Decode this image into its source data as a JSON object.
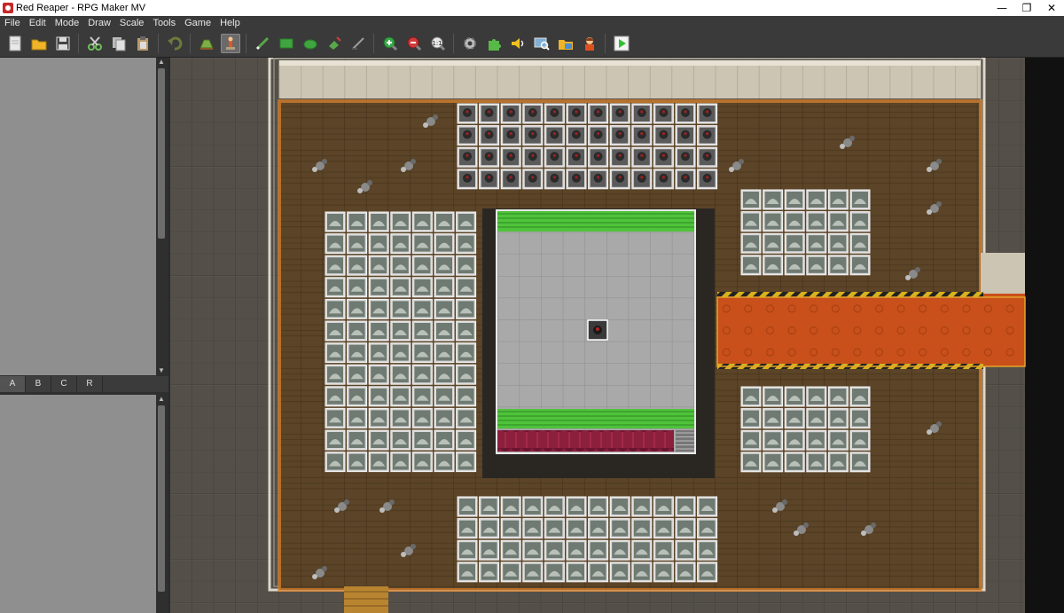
{
  "window": {
    "title": "Red Reaper - RPG Maker MV",
    "buttons": {
      "minimize": "—",
      "maximize": "❐",
      "close": "✕"
    }
  },
  "menu": [
    "File",
    "Edit",
    "Mode",
    "Draw",
    "Scale",
    "Tools",
    "Game",
    "Help"
  ],
  "toolbar": {
    "groups": [
      [
        {
          "name": "new-project",
          "icon": "new-icon",
          "color": "#e8e8e8"
        },
        {
          "name": "open-project",
          "icon": "folder-icon",
          "color": "#f0b428"
        },
        {
          "name": "save-project",
          "icon": "save-icon",
          "color": "#dcdcdc"
        }
      ],
      [
        {
          "name": "cut",
          "icon": "scissors-icon",
          "color": "#6fbf5a"
        },
        {
          "name": "copy",
          "icon": "copy-icon",
          "color": "#e0e0e0"
        },
        {
          "name": "paste",
          "icon": "paste-icon",
          "color": "#b89a6a"
        }
      ],
      [
        {
          "name": "undo",
          "icon": "undo-icon",
          "color": "#6c7a3c"
        }
      ],
      [
        {
          "name": "map-mode",
          "icon": "map-mode-icon",
          "color": "#7fae48"
        },
        {
          "name": "event-mode",
          "icon": "event-mode-icon",
          "color": "#e0581c",
          "active": true
        }
      ],
      [
        {
          "name": "pencil",
          "icon": "pencil-icon",
          "color": "#5aa64a"
        },
        {
          "name": "rectangle",
          "icon": "rectangle-icon",
          "color": "#3fa53f"
        },
        {
          "name": "ellipse",
          "icon": "ellipse-icon",
          "color": "#3fa53f"
        },
        {
          "name": "flood-fill",
          "icon": "flood-fill-icon",
          "color": "#5aa64a"
        },
        {
          "name": "shadow-pen",
          "icon": "shadow-pen-icon",
          "color": "#9c9c9c"
        }
      ],
      [
        {
          "name": "zoom-in",
          "icon": "zoom-in-icon",
          "color": "#3aa64a"
        },
        {
          "name": "zoom-out",
          "icon": "zoom-out-icon",
          "color": "#d03a3a"
        },
        {
          "name": "zoom-actual",
          "icon": "zoom-actual-icon",
          "color": "#e8e8e8"
        }
      ],
      [
        {
          "name": "database",
          "icon": "gear-icon",
          "color": "#bcbcbc"
        },
        {
          "name": "plugin-manager",
          "icon": "plugin-icon",
          "color": "#58b848"
        },
        {
          "name": "sound-test",
          "icon": "speaker-icon",
          "color": "#f0c020"
        },
        {
          "name": "event-searcher",
          "icon": "event-search-icon",
          "color": "#7fb0d8"
        },
        {
          "name": "resource-manager",
          "icon": "resource-icon",
          "color": "#f0b428"
        },
        {
          "name": "character-generator",
          "icon": "character-icon",
          "color": "#e0501c"
        }
      ],
      [
        {
          "name": "playtest",
          "icon": "play-icon",
          "color": "#30c030"
        }
      ]
    ]
  },
  "tileset_tabs": [
    "A",
    "B",
    "C",
    "R"
  ],
  "selected_tab": "A",
  "colors": {
    "floor": "#5b4427",
    "floor_edge": "#d7802c",
    "outer_tile": "#545049",
    "wall_top": "#cdc5b3",
    "stage_floor": "#a9a9a9",
    "stage_rail": "#4fc33a",
    "curtain": "#8c1f3c",
    "carpet": "#c9501a",
    "hazard": "#d6b21e"
  }
}
